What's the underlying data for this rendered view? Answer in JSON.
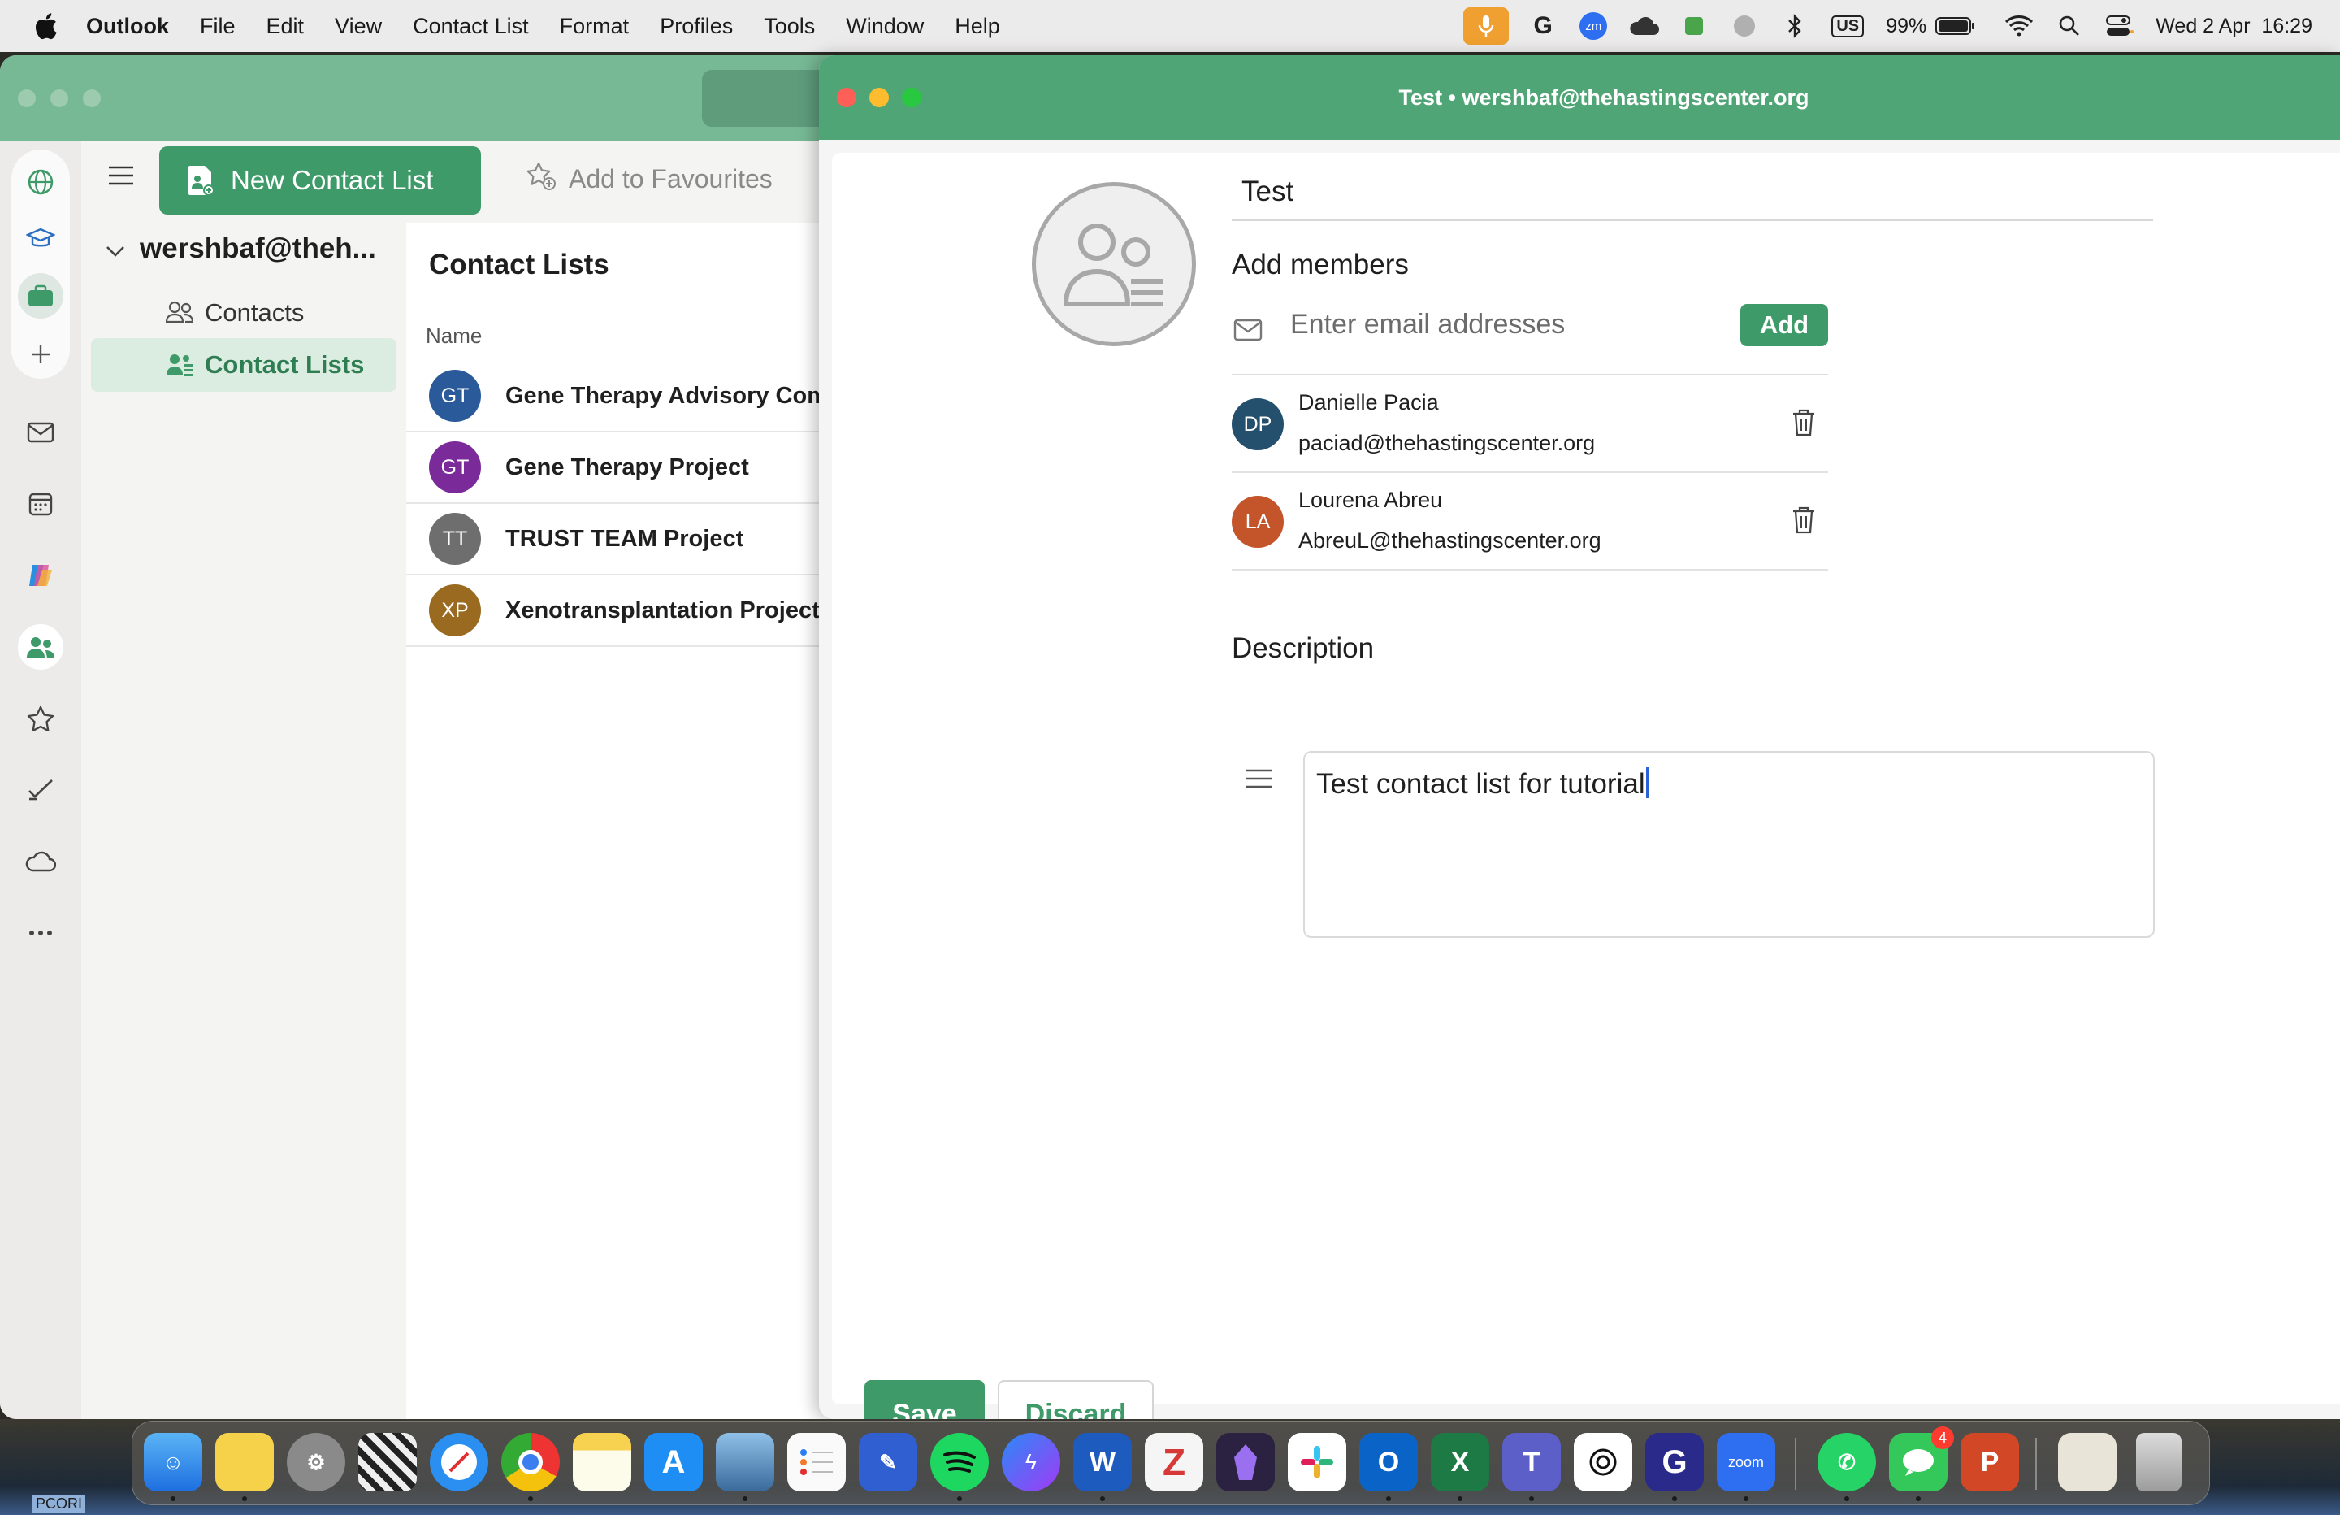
{
  "menubar": {
    "app": "Outlook",
    "items": [
      "File",
      "Edit",
      "View",
      "Contact List",
      "Format",
      "Profiles",
      "Tools",
      "Window",
      "Help"
    ],
    "battery": "99%",
    "keyboard": "US",
    "datetime": "Wed 2 Apr  16:29"
  },
  "toolbar": {
    "new_contact_list": "New Contact List",
    "add_to_favourites": "Add to Favourites"
  },
  "nav": {
    "account": "wershbaf@theh...",
    "items": [
      {
        "label": "Contacts",
        "icon": "contacts-icon"
      },
      {
        "label": "Contact Lists",
        "icon": "contact-lists-icon",
        "active": true
      }
    ]
  },
  "list_pane": {
    "title": "Contact Lists",
    "column_name": "Name",
    "rows": [
      {
        "initials": "GT",
        "name": "Gene Therapy Advisory Committee",
        "color": "#2a5a9a"
      },
      {
        "initials": "GT",
        "name": "Gene Therapy Project",
        "color": "#7b2a9a"
      },
      {
        "initials": "TT",
        "name": "TRUST TEAM Project",
        "color": "#6e6e6e"
      },
      {
        "initials": "XP",
        "name": "Xenotransplantation Project",
        "color": "#9a6a20"
      }
    ]
  },
  "editor": {
    "window_title": "Test • wershbaf@thehastingscenter.org",
    "list_name": "Test",
    "add_members_label": "Add members",
    "email_placeholder": "Enter email addresses",
    "add_button": "Add",
    "members": [
      {
        "initials": "DP",
        "name": "Danielle Pacia",
        "email": "paciad@thehastingscenter.org",
        "color": "#24506e"
      },
      {
        "initials": "LA",
        "name": "Lourena Abreu",
        "email": "AbreuL@thehastingscenter.org",
        "color": "#c4542a"
      }
    ],
    "description_label": "Description",
    "description_value": "Test contact list for tutorial",
    "save_button": "Save",
    "discard_button": "Discard"
  },
  "dock": {
    "messages_badge": "4",
    "zoom_label": "zoom",
    "desktop_label": "PCORI"
  },
  "colors": {
    "accent": "#3e9a68",
    "title_bar": "#4fa575"
  }
}
